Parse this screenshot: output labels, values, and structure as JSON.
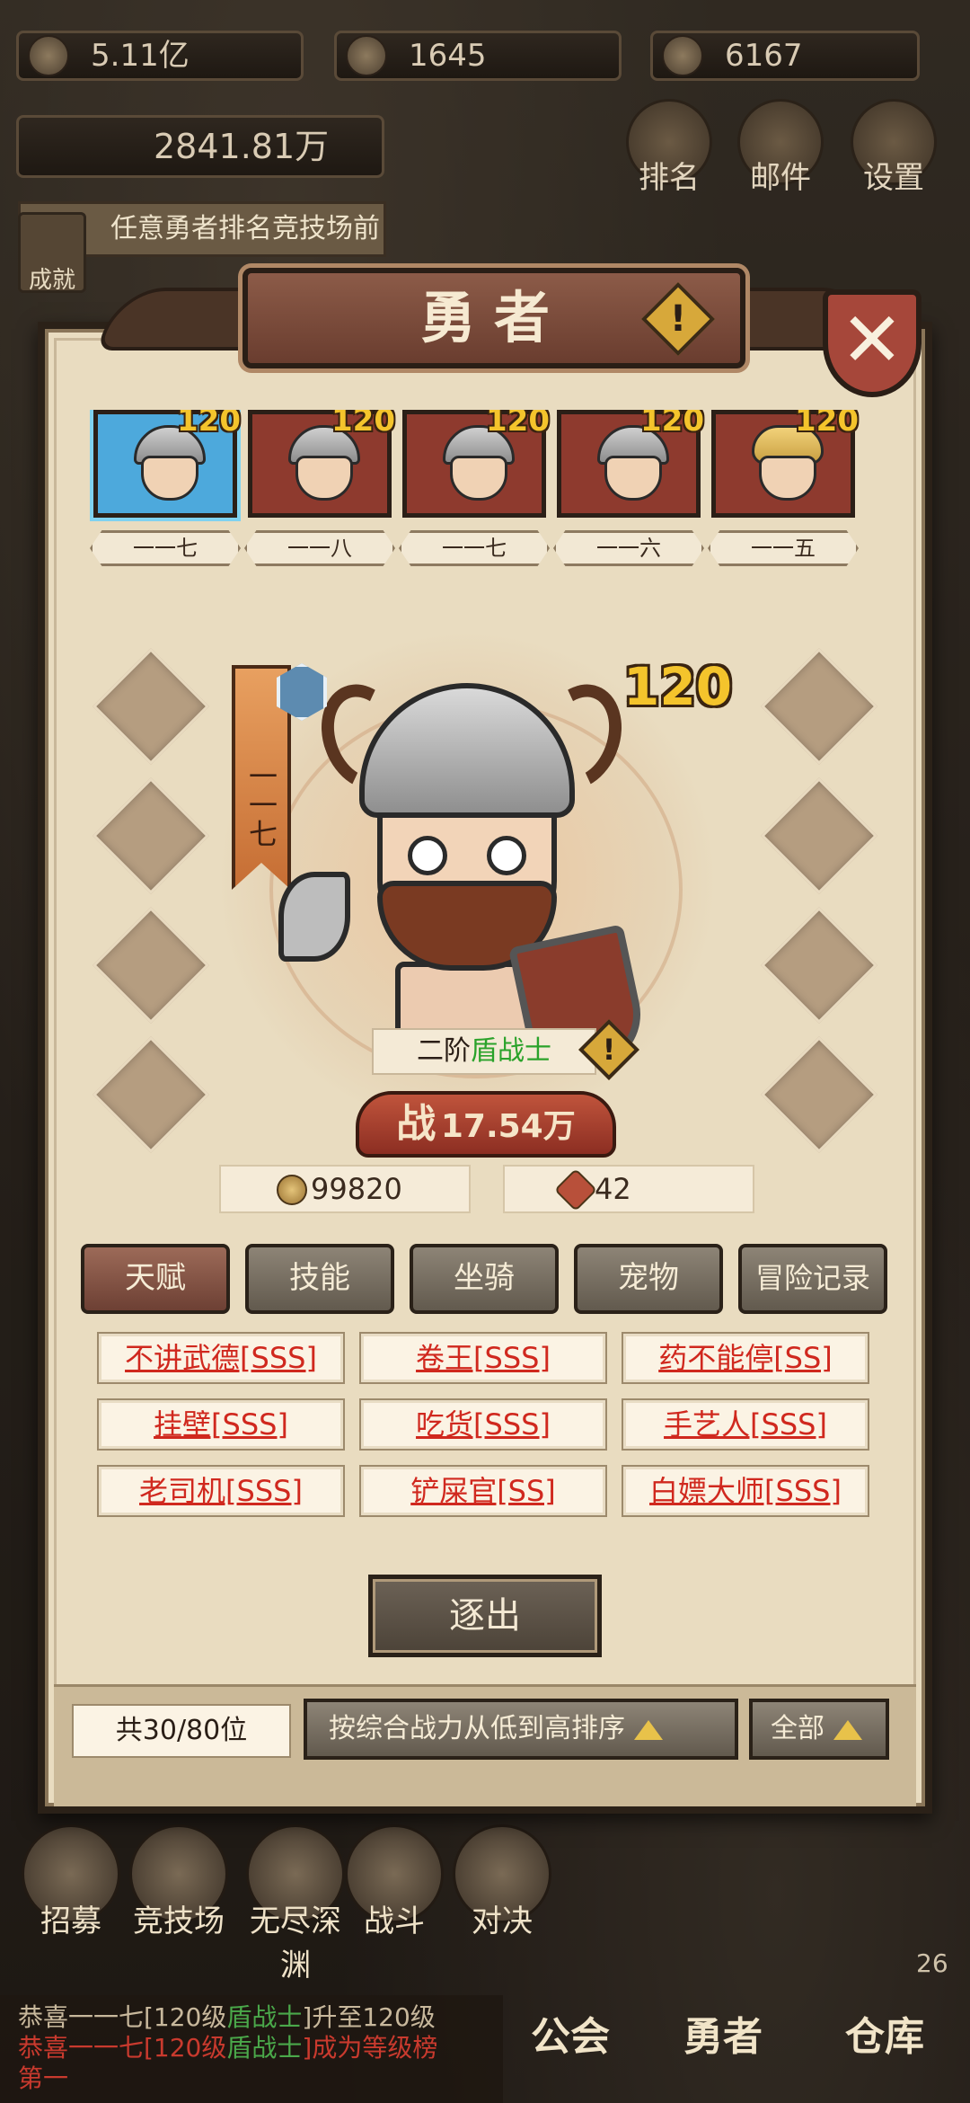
{
  "resources": {
    "gold": "5.11亿",
    "gems": "1645",
    "stamina": "6167",
    "power": "2841.81万"
  },
  "quest": {
    "text": "任意勇者排名竞技场前",
    "icon_label": "成就"
  },
  "top_nav": [
    "排名",
    "邮件",
    "设置"
  ],
  "panel": {
    "title": "勇者",
    "close_icon": "close-icon"
  },
  "heroes": [
    {
      "level": "120",
      "name": "一一七"
    },
    {
      "level": "120",
      "name": "一一八"
    },
    {
      "level": "120",
      "name": "一一七"
    },
    {
      "level": "120",
      "name": "一一六"
    },
    {
      "level": "120",
      "name": "一一五"
    }
  ],
  "selected_hero": {
    "rank_banner": "一一七",
    "level": "120",
    "class_prefix": "二阶",
    "class_name": "盾战士",
    "power_label": "战",
    "power": "17.54万",
    "coins": "99820",
    "fragments": "42"
  },
  "tabs": [
    "天赋",
    "技能",
    "坐骑",
    "宠物",
    "冒险记录"
  ],
  "talents": [
    "不讲武德[SSS]",
    "卷王[SSS]",
    "药不能停[SS]",
    "挂壁[SSS]",
    "吃货[SSS]",
    "手艺人[SSS]",
    "老司机[SSS]",
    "铲屎官[SS]",
    "白嫖大师[SSS]"
  ],
  "expel_label": "逐出",
  "footer": {
    "count": "共30/80位",
    "sort": "按综合战力从低到高排序",
    "filter": "全部"
  },
  "bottom_nav": [
    "招募",
    "竞技场",
    "无尽深渊",
    "战斗",
    "对决"
  ],
  "ticker": {
    "line1_a": "恭喜一一七[120级",
    "line1_b": "盾战士",
    "line1_c": "]升至120级",
    "line2_a": "恭喜一一七[120级",
    "line2_b": "盾战士",
    "line2_c": "]成为等级榜",
    "line3": "第一"
  },
  "bottom_tabs": [
    "公会",
    "勇者",
    "仓库"
  ],
  "badge": "26"
}
